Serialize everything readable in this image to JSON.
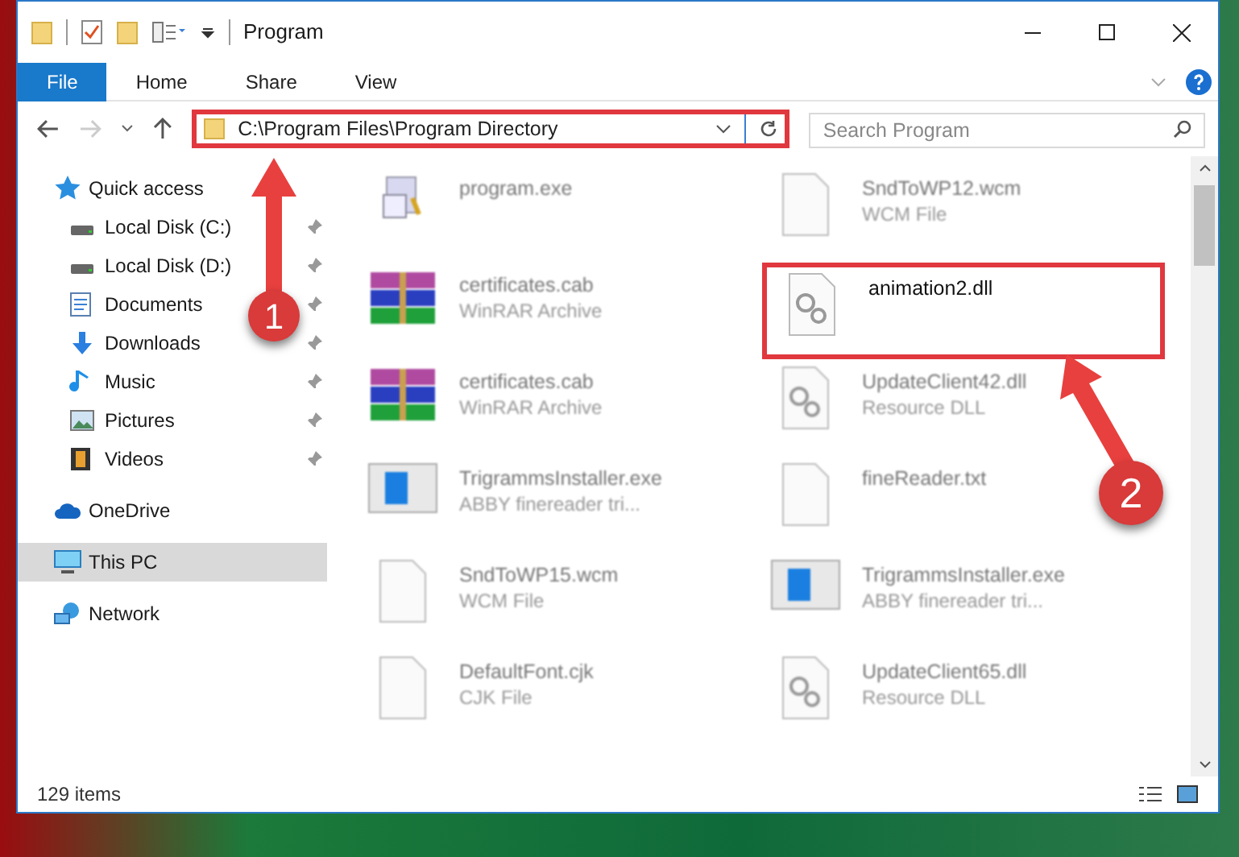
{
  "window": {
    "title": "Program"
  },
  "ribbon_tabs": [
    {
      "label": "File",
      "selected": true
    },
    {
      "label": "Home",
      "selected": false
    },
    {
      "label": "Share",
      "selected": false
    },
    {
      "label": "View",
      "selected": false
    }
  ],
  "address_bar": {
    "path": "C:\\Program Files\\Program Directory"
  },
  "search": {
    "placeholder": "Search Program"
  },
  "sidebar": {
    "items": [
      {
        "label": "Quick access",
        "kind": "star",
        "pinned": false,
        "selected": false,
        "children": [
          {
            "label": "Local Disk (C:)",
            "kind": "disk",
            "pinned": true,
            "selected": false
          },
          {
            "label": "Local Disk (D:)",
            "kind": "disk",
            "pinned": true,
            "selected": false
          },
          {
            "label": "Documents",
            "kind": "doc",
            "pinned": true,
            "selected": false
          },
          {
            "label": "Downloads",
            "kind": "download",
            "pinned": true,
            "selected": false
          },
          {
            "label": "Music",
            "kind": "music",
            "pinned": true,
            "selected": false
          },
          {
            "label": "Pictures",
            "kind": "picture",
            "pinned": true,
            "selected": false
          },
          {
            "label": "Videos",
            "kind": "video",
            "pinned": true,
            "selected": false
          }
        ]
      },
      {
        "label": "OneDrive",
        "kind": "cloud",
        "pinned": false,
        "selected": false
      },
      {
        "label": "This PC",
        "kind": "pc",
        "pinned": false,
        "selected": true
      },
      {
        "label": "Network",
        "kind": "network",
        "pinned": false,
        "selected": false
      }
    ]
  },
  "files": [
    {
      "name": "program.exe",
      "kind": "exe",
      "highlighted": false
    },
    {
      "name": "SndToWP12.wcm",
      "type": "WCM File",
      "kind": "blank",
      "highlighted": false
    },
    {
      "name": "certificates.cab",
      "type": "WinRAR Archive",
      "kind": "archive",
      "highlighted": false
    },
    {
      "name": "animation2.dll",
      "kind": "dll",
      "highlighted": true
    },
    {
      "name": "certificates.cab",
      "type": "WinRAR Archive",
      "kind": "archive",
      "highlighted": false
    },
    {
      "name": "UpdateClient42.dll",
      "type": "Resource DLL",
      "kind": "dll",
      "highlighted": false
    },
    {
      "name": "TrigrammsInstaller.exe",
      "type": "ABBY finereader tri...",
      "kind": "installer",
      "highlighted": false
    },
    {
      "name": "fineReader.txt",
      "kind": "blank",
      "highlighted": false
    },
    {
      "name": "SndToWP15.wcm",
      "type": "WCM File",
      "kind": "blank",
      "highlighted": false
    },
    {
      "name": "TrigrammsInstaller.exe",
      "type": "ABBY finereader tri...",
      "kind": "installer",
      "highlighted": false
    },
    {
      "name": "DefaultFont.cjk",
      "type": "CJK File",
      "kind": "blank",
      "highlighted": false
    },
    {
      "name": "UpdateClient65.dll",
      "type": "Resource DLL",
      "kind": "dll",
      "highlighted": false
    }
  ],
  "callouts": [
    {
      "label": "1"
    },
    {
      "label": "2"
    }
  ],
  "status_bar": {
    "count": "129 items"
  }
}
